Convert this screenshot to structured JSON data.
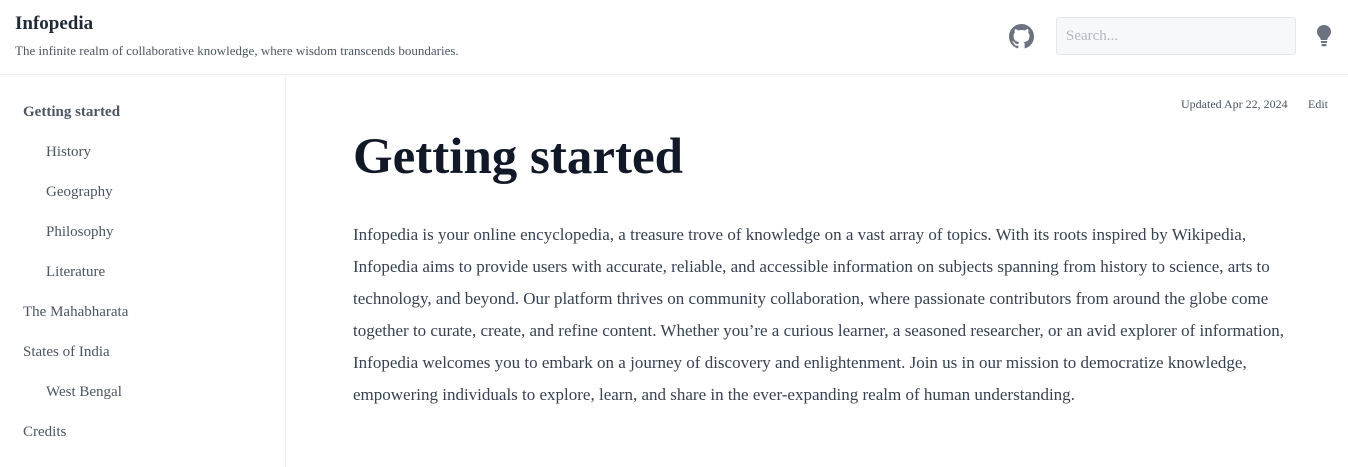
{
  "header": {
    "title": "Infopedia",
    "tagline": "The infinite realm of collaborative knowledge, where wisdom transcends boundaries.",
    "github_icon": "github-icon",
    "search": {
      "placeholder": "Search...",
      "value": ""
    },
    "theme_icon": "lightbulb-icon"
  },
  "sidebar": {
    "items": [
      {
        "label": "Getting started",
        "level": 0,
        "active": true
      },
      {
        "label": "History",
        "level": 1
      },
      {
        "label": "Geography",
        "level": 1
      },
      {
        "label": "Philosophy",
        "level": 1
      },
      {
        "label": "Literature",
        "level": 1
      },
      {
        "label": "The Mahabharata",
        "level": 0
      },
      {
        "label": "States of India",
        "level": 0
      },
      {
        "label": "West Bengal",
        "level": 1
      },
      {
        "label": "Credits",
        "level": 0
      }
    ]
  },
  "main": {
    "updated": "Updated Apr 22, 2024",
    "edit_label": "Edit",
    "title": "Getting started",
    "intro": "Infopedia is your online encyclopedia, a treasure trove of knowledge on a vast array of topics. With its roots inspired by Wikipedia, Infopedia aims to provide users with accurate, reliable, and accessible information on subjects spanning from history to science, arts to technology, and beyond. Our platform thrives on community collaboration, where passionate contributors from around the globe come together to curate, create, and refine content. Whether you’re a curious learner, a seasoned researcher, or an avid explorer of information, Infopedia welcomes you to embark on a journey of discovery and enlightenment. Join us in our mission to democratize knowledge, empowering individuals to explore, learn, and share in the ever-expanding realm of human understanding."
  },
  "colors": {
    "text": "#1f2937",
    "muted": "#4b5563",
    "border": "#eceef1",
    "icon": "#6b7280"
  }
}
